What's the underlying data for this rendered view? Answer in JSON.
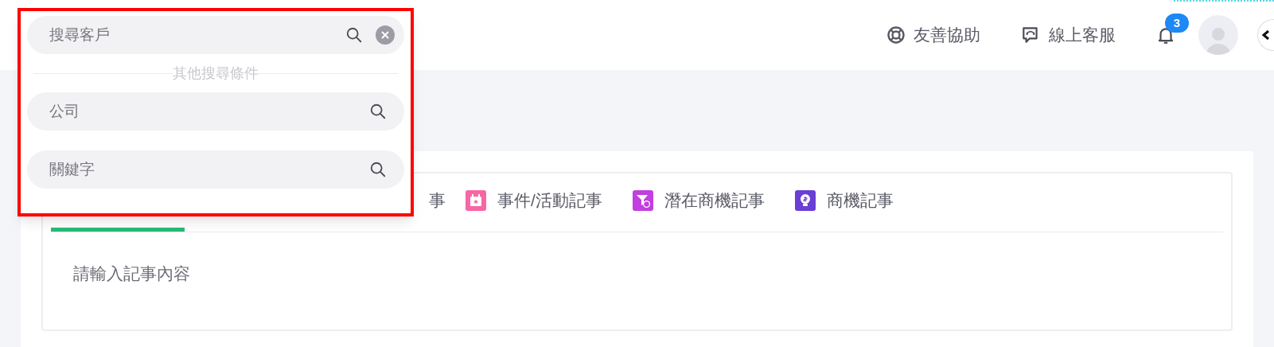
{
  "header": {
    "actions": [
      {
        "kind": "lifebuoy",
        "label": "友善協助"
      },
      {
        "kind": "support",
        "label": "線上客服"
      }
    ],
    "notifications": {
      "count": "3"
    }
  },
  "search_popup": {
    "main_field": {
      "placeholder": "搜尋客戶"
    },
    "divider_label": "其他搜尋條件",
    "fields": [
      {
        "placeholder": "公司"
      },
      {
        "placeholder": "關鍵字"
      }
    ]
  },
  "tabs": [
    {
      "selected": true
    },
    {
      "label": "事",
      "selected": false
    },
    {
      "kind": "calendar",
      "color": "#f766a5",
      "label": "事件/活動記事",
      "selected": false
    },
    {
      "kind": "funnel",
      "color": "#c23fe0",
      "label": "潛在商機記事",
      "selected": false
    },
    {
      "kind": "bulb",
      "color": "#6a3fd6",
      "label": "商機記事",
      "selected": false
    }
  ],
  "editor": {
    "placeholder": "請輸入記事內容"
  }
}
